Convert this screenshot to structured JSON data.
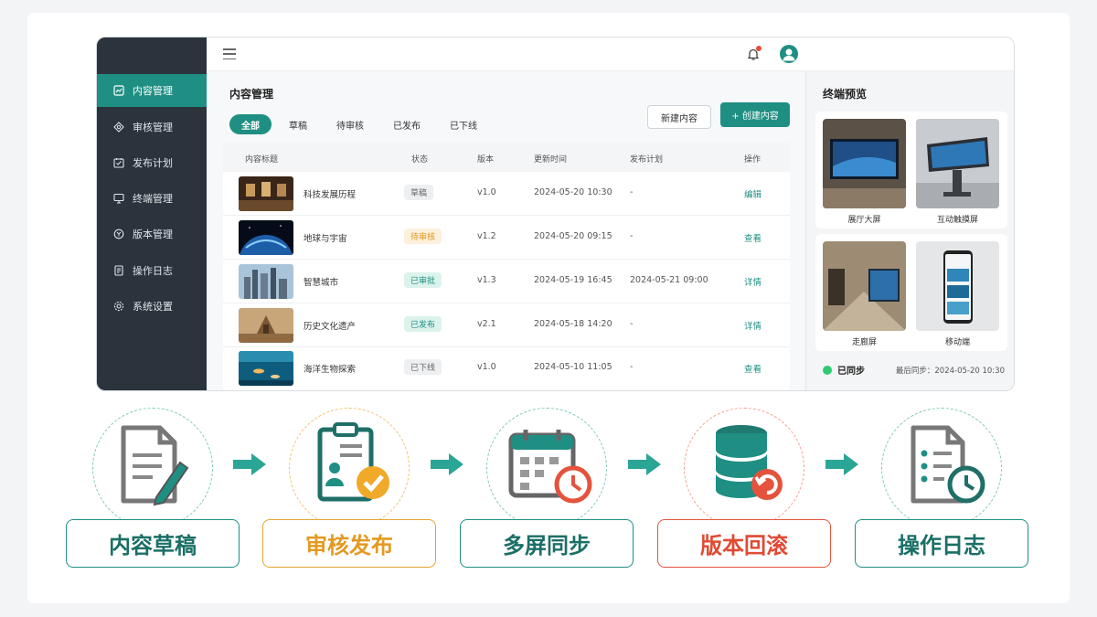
{
  "sidebar": {
    "items": [
      {
        "label": "内容管理",
        "icon": "content-icon",
        "active": true
      },
      {
        "label": "审核管理",
        "icon": "review-icon"
      },
      {
        "label": "发布计划",
        "icon": "calendar-icon"
      },
      {
        "label": "终端管理",
        "icon": "monitor-icon"
      },
      {
        "label": "版本管理",
        "icon": "version-icon"
      },
      {
        "label": "操作日志",
        "icon": "log-icon"
      },
      {
        "label": "系统设置",
        "icon": "gear-icon"
      }
    ]
  },
  "main": {
    "title": "内容管理",
    "tabs": [
      "全部",
      "草稿",
      "待审核",
      "已发布",
      "已下线"
    ],
    "new_button": "新建内容",
    "create_button": "+ 创建内容",
    "columns": [
      "内容标题",
      "状态",
      "版本",
      "更新时间",
      "发布计划",
      "操作"
    ],
    "rows": [
      {
        "title": "科技发展历程",
        "status": "草稿",
        "version": "v1.0",
        "updated": "2024-05-20 10:30",
        "plan": "-",
        "action": "编辑"
      },
      {
        "title": "地球与宇宙",
        "status": "待审核",
        "version": "v1.2",
        "updated": "2024-05-20 09:15",
        "plan": "-",
        "action": "查看"
      },
      {
        "title": "智慧城市",
        "status": "已审批",
        "version": "v1.3",
        "updated": "2024-05-19 16:45",
        "plan": "2024-05-21 09:00",
        "action": "详情"
      },
      {
        "title": "历史文化遗产",
        "status": "已发布",
        "version": "v2.1",
        "updated": "2024-05-18 14:20",
        "plan": "-",
        "action": "详情"
      },
      {
        "title": "海洋生物探索",
        "status": "已下线",
        "version": "v1.0",
        "updated": "2024-05-10 11:05",
        "plan": "-",
        "action": "查看"
      }
    ]
  },
  "preview": {
    "title": "终端预览",
    "terminals": [
      "展厅大屏",
      "互动触摸屏",
      "走廊屏",
      "移动端"
    ],
    "sync_status": "已同步",
    "last_sync": "最后同步：2024-05-20 10:30"
  },
  "workflow": {
    "steps": [
      {
        "label": "内容草稿",
        "icon": "document-edit-icon",
        "color": "#1f8f83"
      },
      {
        "label": "审核发布",
        "icon": "clipboard-check-icon",
        "color": "#e3a52f"
      },
      {
        "label": "多屏同步",
        "icon": "calendar-clock-icon",
        "color": "#1f8f83"
      },
      {
        "label": "版本回滚",
        "icon": "database-rollback-icon",
        "color": "#e5533d"
      },
      {
        "label": "操作日志",
        "icon": "checklist-clock-icon",
        "color": "#1f8f83"
      }
    ]
  },
  "colors": {
    "accent": "#1f8f83",
    "sidebar": "#2b343d",
    "warning": "#e3a52f",
    "danger": "#e5533d"
  }
}
